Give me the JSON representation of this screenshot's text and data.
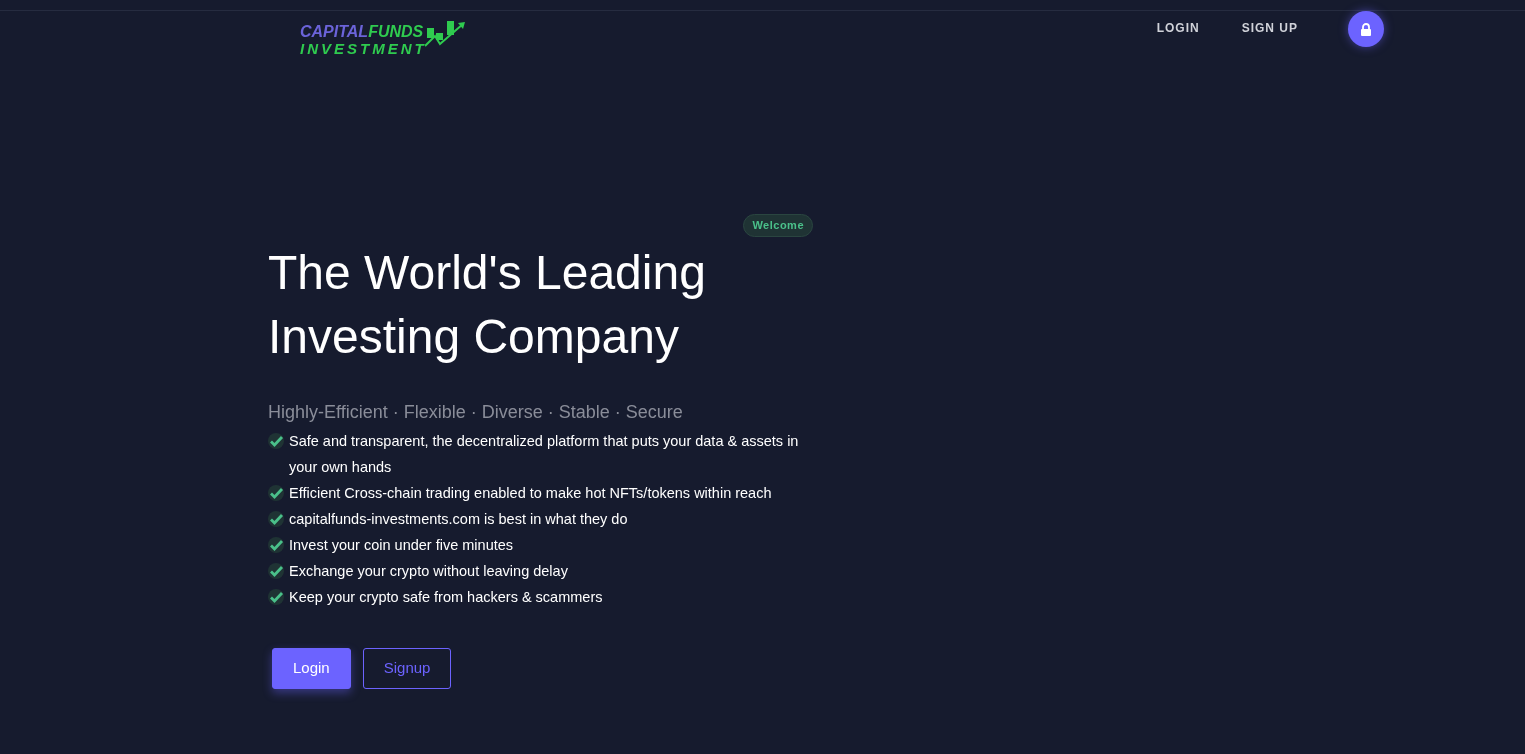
{
  "logo": {
    "word_1": "CAPITAL",
    "word_2": "FUNDS",
    "word_3": "INVESTMENT"
  },
  "nav": [
    {
      "label": "LOGIN"
    },
    {
      "label": "SIGN UP"
    }
  ],
  "hero": {
    "badge": "Welcome",
    "title_lines": [
      "The World's Leading",
      "Investing Company"
    ],
    "tagline": "Highly-Efficient · Flexible · Diverse · Stable · Secure",
    "features": [
      "Safe and transparent, the decentralized platform that puts your data & assets in your own hands",
      "Efficient Cross-chain trading enabled to make hot NFTs/tokens within reach",
      "capitalfunds-investments.com is best in what they do",
      "Invest your coin under five minutes",
      "Exchange your crypto without leaving delay",
      "Keep your crypto safe from hackers & scammers"
    ],
    "buttons": [
      {
        "label": "Login",
        "kind": "primary"
      },
      {
        "label": "Signup",
        "kind": "outline"
      }
    ]
  }
}
